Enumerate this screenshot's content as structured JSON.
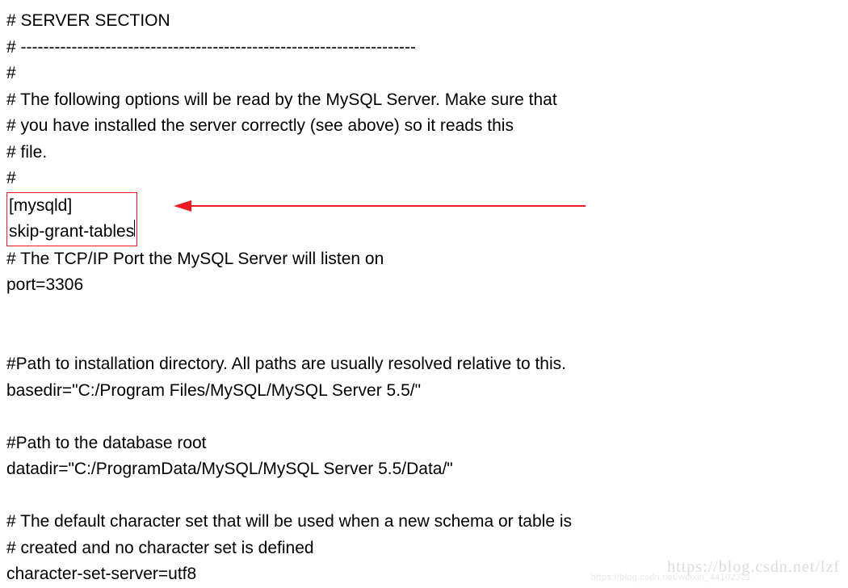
{
  "lines": {
    "l1": "# SERVER SECTION",
    "l2": "# ----------------------------------------------------------------------",
    "l3": "#",
    "l4": "# The following options will be read by the MySQL Server. Make sure that",
    "l5": "# you have installed the server correctly (see above) so it reads this",
    "l6": "# file.",
    "l7": "#",
    "l8": "[mysqld]",
    "l9": "skip-grant-tables",
    "l10": "# The TCP/IP Port the MySQL Server will listen on",
    "l11": "port=3306",
    "l12": "#Path to installation directory. All paths are usually resolved relative to this.",
    "l13": "basedir=\"C:/Program Files/MySQL/MySQL Server 5.5/\"",
    "l14": "#Path to the database root",
    "l15": "datadir=\"C:/ProgramData/MySQL/MySQL Server 5.5/Data/\"",
    "l16": "# The default character set that will be used when a new schema or table is",
    "l17": "# created and no character set is defined",
    "l18": "character-set-server=utf8"
  },
  "annotation": {
    "highlight_color": "#ed1c24",
    "arrow_color": "#ed1c24"
  },
  "watermark": {
    "main": "https://blog.csdn.net/lzf",
    "sub": "https://blog.csdn.net/weixin_44102321"
  }
}
